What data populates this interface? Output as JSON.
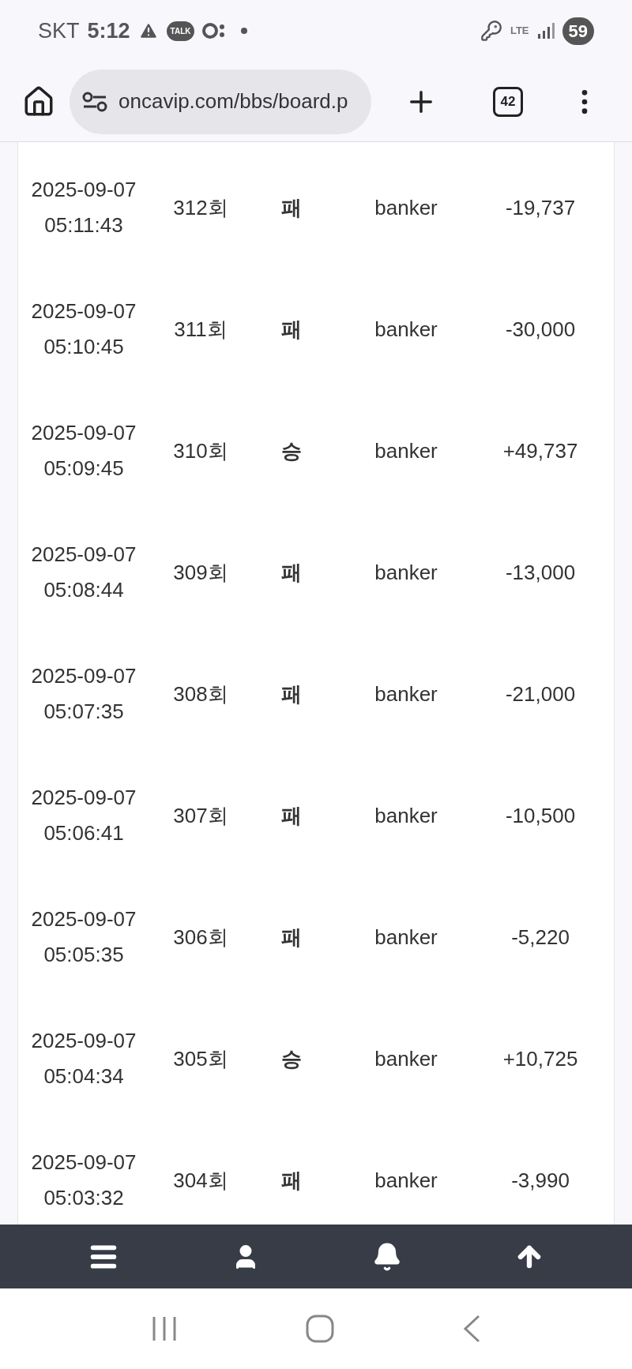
{
  "status_bar": {
    "carrier": "SKT",
    "time": "5:12",
    "talk_badge": "TALK",
    "network": "LTE",
    "battery": "59"
  },
  "browser": {
    "url": "oncavip.com/bbs/board.p",
    "tab_count": "42"
  },
  "rows": [
    {
      "date": "2025-09-07",
      "time": "05:11:43",
      "round": "312회",
      "result": "패",
      "bet": "banker",
      "amount": "-19,737"
    },
    {
      "date": "2025-09-07",
      "time": "05:10:45",
      "round": "311회",
      "result": "패",
      "bet": "banker",
      "amount": "-30,000"
    },
    {
      "date": "2025-09-07",
      "time": "05:09:45",
      "round": "310회",
      "result": "승",
      "bet": "banker",
      "amount": "+49,737"
    },
    {
      "date": "2025-09-07",
      "time": "05:08:44",
      "round": "309회",
      "result": "패",
      "bet": "banker",
      "amount": "-13,000"
    },
    {
      "date": "2025-09-07",
      "time": "05:07:35",
      "round": "308회",
      "result": "패",
      "bet": "banker",
      "amount": "-21,000"
    },
    {
      "date": "2025-09-07",
      "time": "05:06:41",
      "round": "307회",
      "result": "패",
      "bet": "banker",
      "amount": "-10,500"
    },
    {
      "date": "2025-09-07",
      "time": "05:05:35",
      "round": "306회",
      "result": "패",
      "bet": "banker",
      "amount": "-5,220"
    },
    {
      "date": "2025-09-07",
      "time": "05:04:34",
      "round": "305회",
      "result": "승",
      "bet": "banker",
      "amount": "+10,725"
    },
    {
      "date": "2025-09-07",
      "time": "05:03:32",
      "round": "304회",
      "result": "패",
      "bet": "banker",
      "amount": "-3,990"
    }
  ]
}
